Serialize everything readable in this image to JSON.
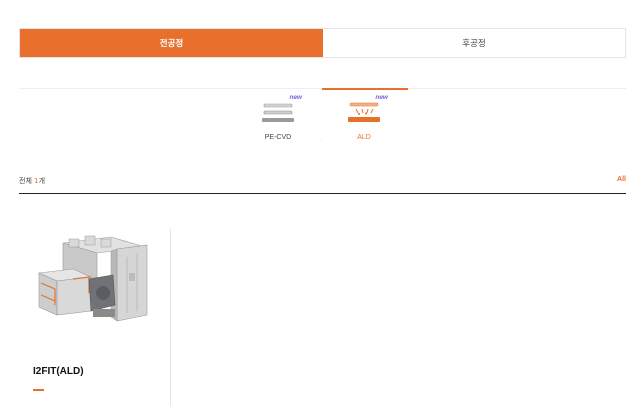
{
  "process_tabs": [
    {
      "label": "전공정",
      "active": true
    },
    {
      "label": "후공정",
      "active": false
    }
  ],
  "categories": [
    {
      "label": "PE-CVD",
      "badge": "new",
      "icon": "pecvd-chamber-icon",
      "active": false
    },
    {
      "label": "ALD",
      "badge": "new",
      "icon": "ald-chamber-icon",
      "active": true
    }
  ],
  "summary": {
    "prefix": "전체",
    "count": "1",
    "suffix": "개"
  },
  "all_link": "All",
  "products": [
    {
      "name": "I2FIT(ALD)",
      "image": "semiconductor-equipment-machine"
    }
  ],
  "colors": {
    "accent": "#e8702c",
    "badge": "#6f67e0",
    "border": "#e5e5e5"
  }
}
